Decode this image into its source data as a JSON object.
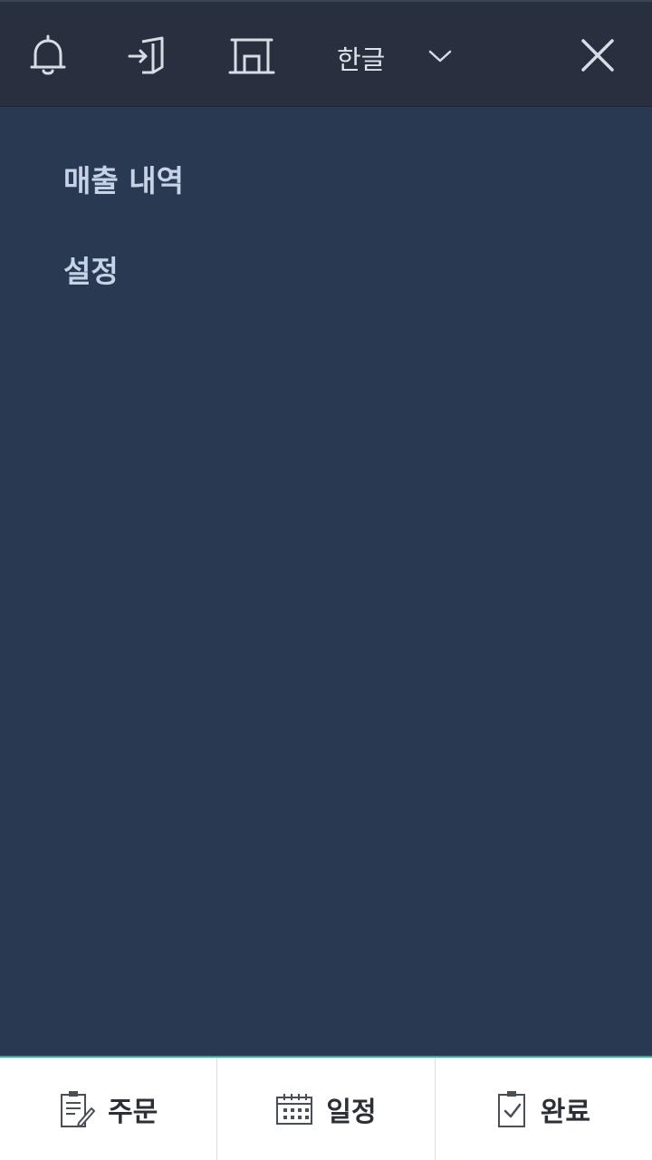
{
  "header": {
    "icons": [
      "bell-icon",
      "logout-icon",
      "store-icon",
      "close-icon"
    ],
    "language": {
      "label": "한글",
      "icon": "chevron-down-icon"
    }
  },
  "menu": {
    "items": [
      {
        "label": "매출 내역"
      },
      {
        "label": "설정"
      }
    ]
  },
  "bottom_nav": {
    "tabs": [
      {
        "label": "주문",
        "icon": "order-clipboard-edit-icon"
      },
      {
        "label": "일정",
        "icon": "calendar-icon"
      },
      {
        "label": "완료",
        "icon": "clipboard-check-icon"
      }
    ]
  },
  "colors": {
    "header_bg": "#28303f",
    "menu_bg": "#2a3952",
    "menu_text": "#c6d2e6",
    "accent": "#2bb48a"
  }
}
